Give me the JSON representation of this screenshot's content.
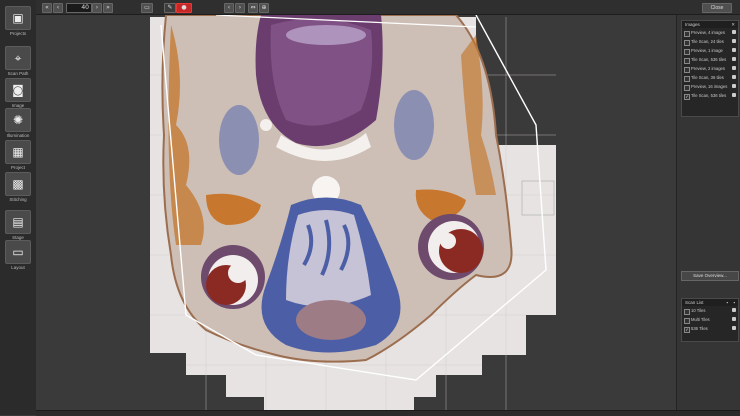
{
  "left_toolbar": {
    "items": [
      {
        "label": "Projects",
        "icon": "projects-icon",
        "glyph": "▣"
      },
      {
        "label": "Scan Path",
        "icon": "scan-path-icon",
        "glyph": "⌖"
      },
      {
        "label": "Image",
        "icon": "camera-icon",
        "glyph": "◙"
      },
      {
        "label": "Illumination",
        "icon": "light-icon",
        "glyph": "✺"
      },
      {
        "label": "Project",
        "icon": "grid-icon",
        "glyph": "▦"
      },
      {
        "label": "Stitching",
        "icon": "stitching-icon",
        "glyph": "▩"
      },
      {
        "label": "Stage",
        "icon": "stage-icon",
        "glyph": "▤"
      },
      {
        "label": "Layout",
        "icon": "layout-icon",
        "glyph": "▭"
      }
    ]
  },
  "top_bar": {
    "zoom_value": "40",
    "close_label": "Close"
  },
  "images_panel": {
    "title": "Images",
    "items": [
      {
        "label": "Preview, 4 images",
        "checked": false
      },
      {
        "label": "Tile Scan, 24 tiles",
        "checked": false
      },
      {
        "label": "Preview, 1 image",
        "checked": false
      },
      {
        "label": "Tile Scan, 536 tiles",
        "checked": false
      },
      {
        "label": "Preview, 2 images",
        "checked": false
      },
      {
        "label": "Tile Scan, 36 tiles",
        "checked": false
      },
      {
        "label": "Preview, 16 images",
        "checked": false
      },
      {
        "label": "Tile Scan, 536 tiles",
        "checked": true
      }
    ]
  },
  "save_overview_label": "Save Overview...",
  "scan_list": {
    "title": "Scan List",
    "items": [
      {
        "label": "10 Tiles",
        "checked": false
      },
      {
        "label": "Multi Tiles",
        "checked": false
      },
      {
        "label": "536 Tiles",
        "checked": true
      }
    ]
  },
  "colors": {
    "accent_red": "#c62828",
    "background": "#3a3a3a",
    "panel": "#262626"
  }
}
